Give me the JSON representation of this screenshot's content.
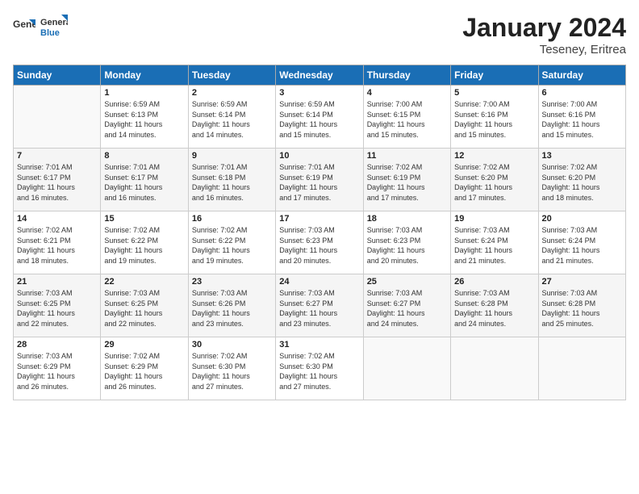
{
  "header": {
    "logo_general": "General",
    "logo_blue": "Blue",
    "title": "January 2024",
    "location": "Teseney, Eritrea"
  },
  "days_of_week": [
    "Sunday",
    "Monday",
    "Tuesday",
    "Wednesday",
    "Thursday",
    "Friday",
    "Saturday"
  ],
  "weeks": [
    [
      {
        "day": "",
        "info": ""
      },
      {
        "day": "1",
        "info": "Sunrise: 6:59 AM\nSunset: 6:13 PM\nDaylight: 11 hours\nand 14 minutes."
      },
      {
        "day": "2",
        "info": "Sunrise: 6:59 AM\nSunset: 6:14 PM\nDaylight: 11 hours\nand 14 minutes."
      },
      {
        "day": "3",
        "info": "Sunrise: 6:59 AM\nSunset: 6:14 PM\nDaylight: 11 hours\nand 15 minutes."
      },
      {
        "day": "4",
        "info": "Sunrise: 7:00 AM\nSunset: 6:15 PM\nDaylight: 11 hours\nand 15 minutes."
      },
      {
        "day": "5",
        "info": "Sunrise: 7:00 AM\nSunset: 6:16 PM\nDaylight: 11 hours\nand 15 minutes."
      },
      {
        "day": "6",
        "info": "Sunrise: 7:00 AM\nSunset: 6:16 PM\nDaylight: 11 hours\nand 15 minutes."
      }
    ],
    [
      {
        "day": "7",
        "info": "Sunrise: 7:01 AM\nSunset: 6:17 PM\nDaylight: 11 hours\nand 16 minutes."
      },
      {
        "day": "8",
        "info": "Sunrise: 7:01 AM\nSunset: 6:17 PM\nDaylight: 11 hours\nand 16 minutes."
      },
      {
        "day": "9",
        "info": "Sunrise: 7:01 AM\nSunset: 6:18 PM\nDaylight: 11 hours\nand 16 minutes."
      },
      {
        "day": "10",
        "info": "Sunrise: 7:01 AM\nSunset: 6:19 PM\nDaylight: 11 hours\nand 17 minutes."
      },
      {
        "day": "11",
        "info": "Sunrise: 7:02 AM\nSunset: 6:19 PM\nDaylight: 11 hours\nand 17 minutes."
      },
      {
        "day": "12",
        "info": "Sunrise: 7:02 AM\nSunset: 6:20 PM\nDaylight: 11 hours\nand 17 minutes."
      },
      {
        "day": "13",
        "info": "Sunrise: 7:02 AM\nSunset: 6:20 PM\nDaylight: 11 hours\nand 18 minutes."
      }
    ],
    [
      {
        "day": "14",
        "info": "Sunrise: 7:02 AM\nSunset: 6:21 PM\nDaylight: 11 hours\nand 18 minutes."
      },
      {
        "day": "15",
        "info": "Sunrise: 7:02 AM\nSunset: 6:22 PM\nDaylight: 11 hours\nand 19 minutes."
      },
      {
        "day": "16",
        "info": "Sunrise: 7:02 AM\nSunset: 6:22 PM\nDaylight: 11 hours\nand 19 minutes."
      },
      {
        "day": "17",
        "info": "Sunrise: 7:03 AM\nSunset: 6:23 PM\nDaylight: 11 hours\nand 20 minutes."
      },
      {
        "day": "18",
        "info": "Sunrise: 7:03 AM\nSunset: 6:23 PM\nDaylight: 11 hours\nand 20 minutes."
      },
      {
        "day": "19",
        "info": "Sunrise: 7:03 AM\nSunset: 6:24 PM\nDaylight: 11 hours\nand 21 minutes."
      },
      {
        "day": "20",
        "info": "Sunrise: 7:03 AM\nSunset: 6:24 PM\nDaylight: 11 hours\nand 21 minutes."
      }
    ],
    [
      {
        "day": "21",
        "info": "Sunrise: 7:03 AM\nSunset: 6:25 PM\nDaylight: 11 hours\nand 22 minutes."
      },
      {
        "day": "22",
        "info": "Sunrise: 7:03 AM\nSunset: 6:25 PM\nDaylight: 11 hours\nand 22 minutes."
      },
      {
        "day": "23",
        "info": "Sunrise: 7:03 AM\nSunset: 6:26 PM\nDaylight: 11 hours\nand 23 minutes."
      },
      {
        "day": "24",
        "info": "Sunrise: 7:03 AM\nSunset: 6:27 PM\nDaylight: 11 hours\nand 23 minutes."
      },
      {
        "day": "25",
        "info": "Sunrise: 7:03 AM\nSunset: 6:27 PM\nDaylight: 11 hours\nand 24 minutes."
      },
      {
        "day": "26",
        "info": "Sunrise: 7:03 AM\nSunset: 6:28 PM\nDaylight: 11 hours\nand 24 minutes."
      },
      {
        "day": "27",
        "info": "Sunrise: 7:03 AM\nSunset: 6:28 PM\nDaylight: 11 hours\nand 25 minutes."
      }
    ],
    [
      {
        "day": "28",
        "info": "Sunrise: 7:03 AM\nSunset: 6:29 PM\nDaylight: 11 hours\nand 26 minutes."
      },
      {
        "day": "29",
        "info": "Sunrise: 7:02 AM\nSunset: 6:29 PM\nDaylight: 11 hours\nand 26 minutes."
      },
      {
        "day": "30",
        "info": "Sunrise: 7:02 AM\nSunset: 6:30 PM\nDaylight: 11 hours\nand 27 minutes."
      },
      {
        "day": "31",
        "info": "Sunrise: 7:02 AM\nSunset: 6:30 PM\nDaylight: 11 hours\nand 27 minutes."
      },
      {
        "day": "",
        "info": ""
      },
      {
        "day": "",
        "info": ""
      },
      {
        "day": "",
        "info": ""
      }
    ]
  ]
}
